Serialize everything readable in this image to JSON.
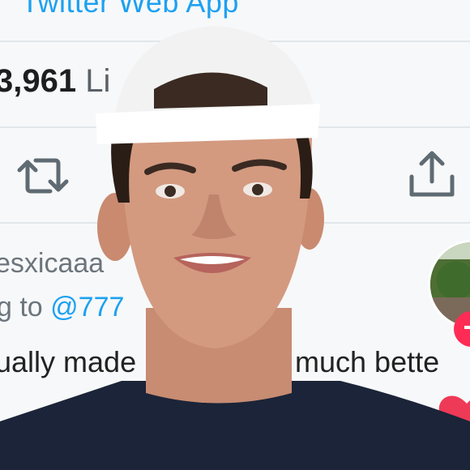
{
  "tweet": {
    "app_link": "Twitter Web App",
    "likes_count": "3,961",
    "likes_label": "Li",
    "handle": "esxicaaa",
    "reply_prefix": "g to ",
    "reply_mention": "@777",
    "text_part1": "ually made",
    "text_part2": "o much bette"
  },
  "actions": {
    "retweet_icon": "retweet-icon",
    "share_icon": "share-icon"
  },
  "overlay": {
    "follow_symbol": "+",
    "heart_icon": "heart-icon"
  },
  "colors": {
    "link_blue": "#1da1f2",
    "tiktok_red": "#fe2c55"
  }
}
